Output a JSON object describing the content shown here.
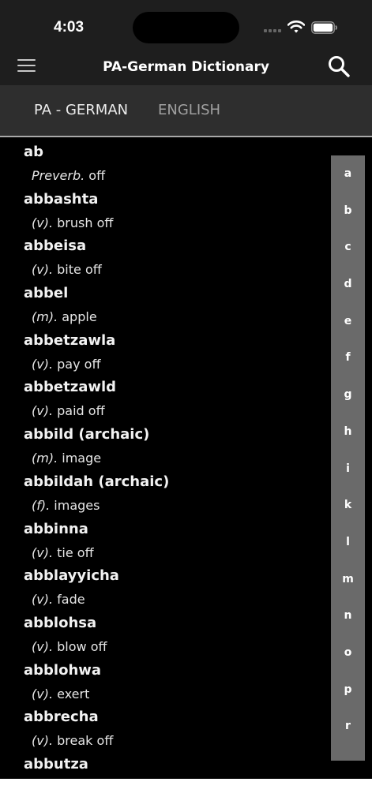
{
  "status": {
    "time": "4:03"
  },
  "header": {
    "title": "PA-German Dictionary"
  },
  "tabs": [
    {
      "label": "PA - GERMAN"
    },
    {
      "label": "ENGLISH"
    }
  ],
  "entries": [
    {
      "word": "ab",
      "pos": "Preverb.",
      "meaning": "off"
    },
    {
      "word": "abbashta",
      "pos": "(v).",
      "meaning": "brush off"
    },
    {
      "word": "abbeisa",
      "pos": "(v).",
      "meaning": "bite off"
    },
    {
      "word": "abbel",
      "pos": "(m).",
      "meaning": "apple"
    },
    {
      "word": "abbetzawla",
      "pos": "(v).",
      "meaning": "pay off"
    },
    {
      "word": "abbetzawld",
      "pos": "(v).",
      "meaning": "paid off"
    },
    {
      "word": "abbild (archaic)",
      "pos": "(m).",
      "meaning": "image"
    },
    {
      "word": "abbildah (archaic)",
      "pos": "(f).",
      "meaning": "images"
    },
    {
      "word": "abbinna",
      "pos": "(v).",
      "meaning": "tie off"
    },
    {
      "word": "abblayyicha",
      "pos": "(v).",
      "meaning": "fade"
    },
    {
      "word": "abblohsa",
      "pos": "(v).",
      "meaning": "blow off"
    },
    {
      "word": "abblohwa",
      "pos": "(v).",
      "meaning": "exert"
    },
    {
      "word": "abbrecha",
      "pos": "(v).",
      "meaning": "break off"
    },
    {
      "word": "abbutza",
      "pos": "",
      "meaning": ""
    }
  ],
  "index_letters": [
    "a",
    "b",
    "c",
    "d",
    "e",
    "f",
    "g",
    "h",
    "i",
    "k",
    "l",
    "m",
    "n",
    "o",
    "p",
    "r"
  ]
}
